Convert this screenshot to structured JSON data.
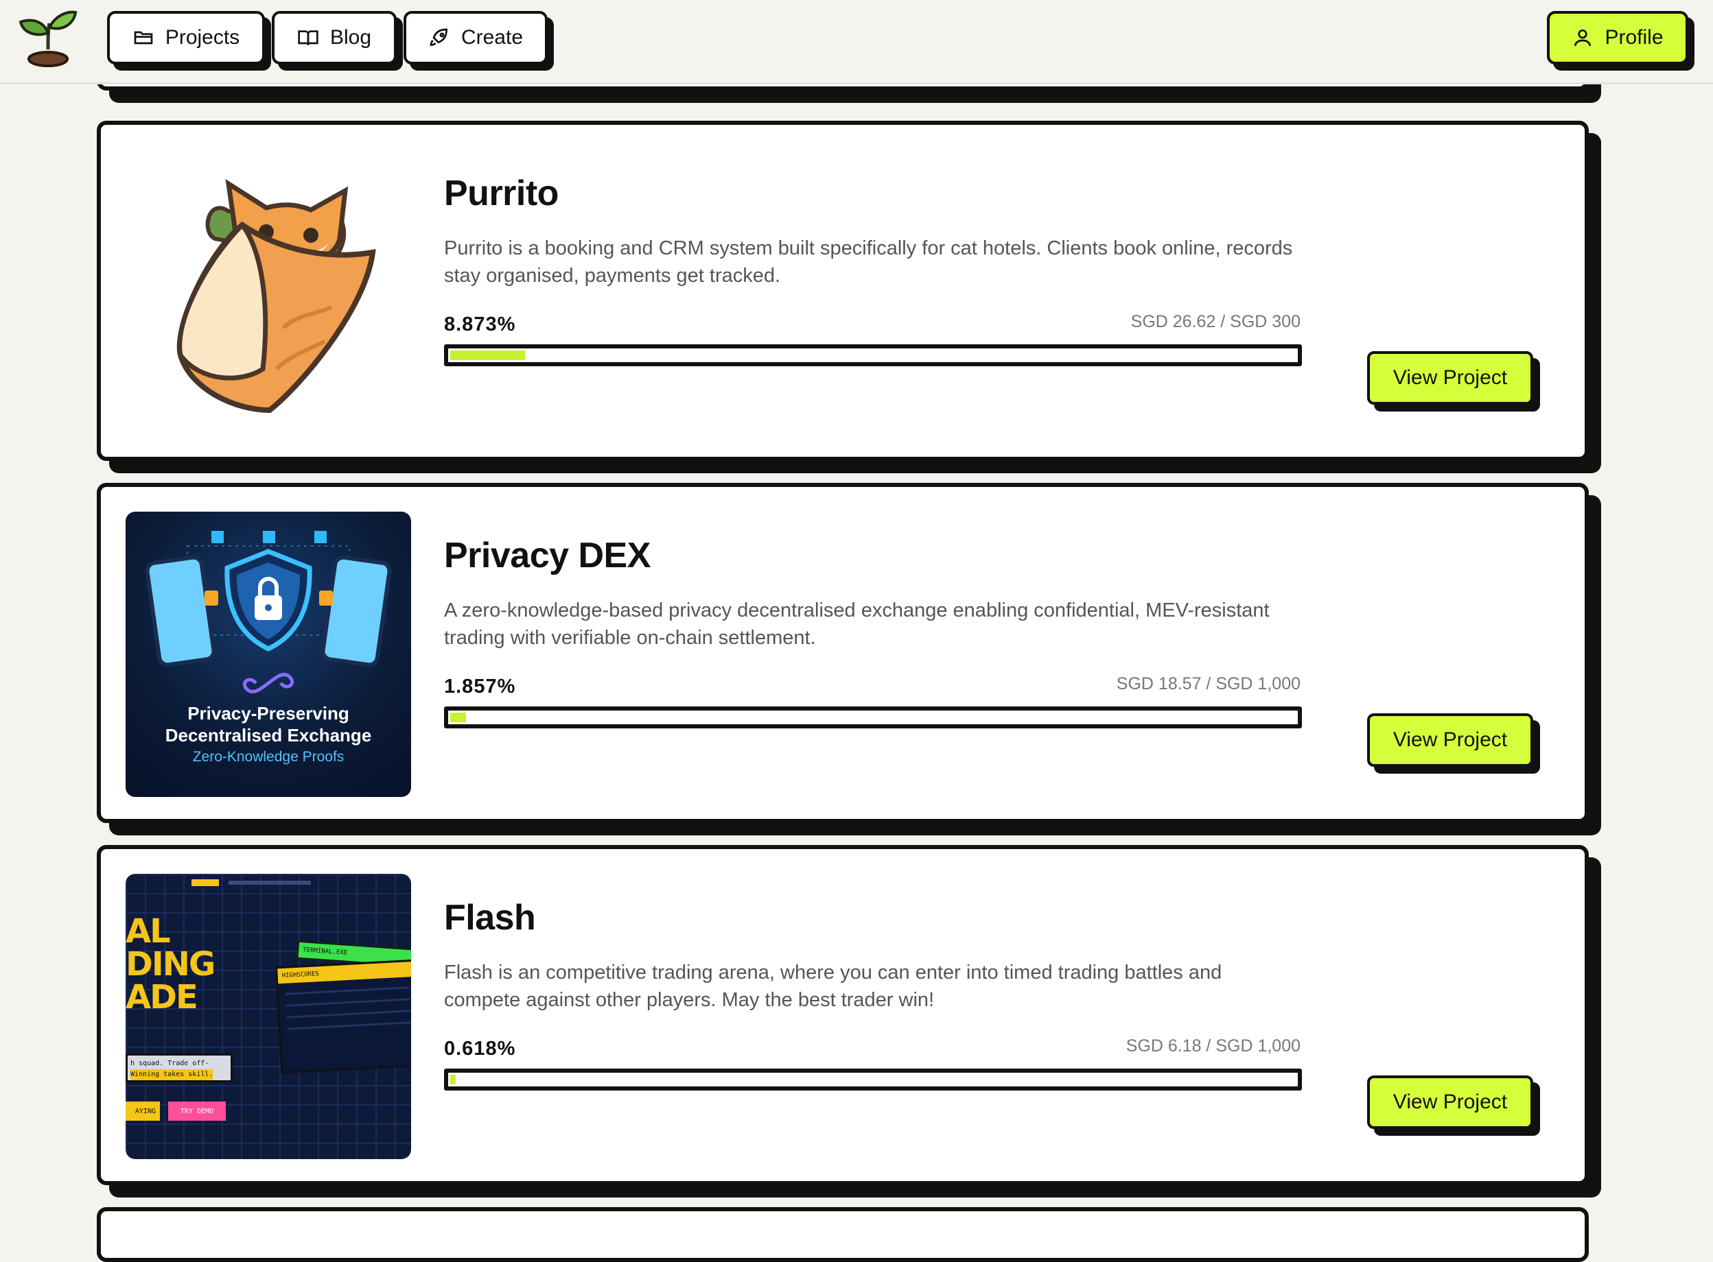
{
  "header": {
    "nav": [
      {
        "label": "Projects",
        "icon": "folder-icon"
      },
      {
        "label": "Blog",
        "icon": "book-icon"
      },
      {
        "label": "Create",
        "icon": "rocket-icon"
      }
    ],
    "profile_label": "Profile",
    "accent_color": "#d4ff3a"
  },
  "projects": [
    {
      "title": "Purrito",
      "description": "Purrito is a booking and CRM system built specifically for cat hotels. Clients book online, records stay organised, payments get tracked.",
      "percent_label": "8.873%",
      "amount": "SGD 26.62 / SGD 300",
      "progress": 0.0887,
      "button_label": "View Project"
    },
    {
      "title": "Privacy DEX",
      "description": "A zero-knowledge-based privacy decentralised exchange enabling confidential, MEV-resistant trading with verifiable on-chain settlement.",
      "percent_label": "1.857%",
      "amount": "SGD 18.57 / SGD 1,000",
      "progress": 0.0186,
      "button_label": "View Project",
      "image_text": {
        "line1": "Privacy-Preserving",
        "line2": "Decentralised Exchange",
        "line3": "Zero-Knowledge Proofs"
      }
    },
    {
      "title": "Flash",
      "description": "Flash is an competitive trading arena, where you can enter into timed trading battles and compete against other players. May the best trader win!",
      "percent_label": "0.618%",
      "amount": "SGD 6.18 / SGD 1,000",
      "progress": 0.0062,
      "button_label": "View Project",
      "image_text": {
        "big1": "AL",
        "big2": "DING",
        "big3": "ADE",
        "panel_tab": "TERMINAL.EXE",
        "panel_title": "HIGHSCORES",
        "try_demo": "TRY DEMO",
        "playing": "AYING",
        "tagline1": "h squad. Trade off-",
        "tagline2": "Winning takes skill."
      }
    }
  ]
}
